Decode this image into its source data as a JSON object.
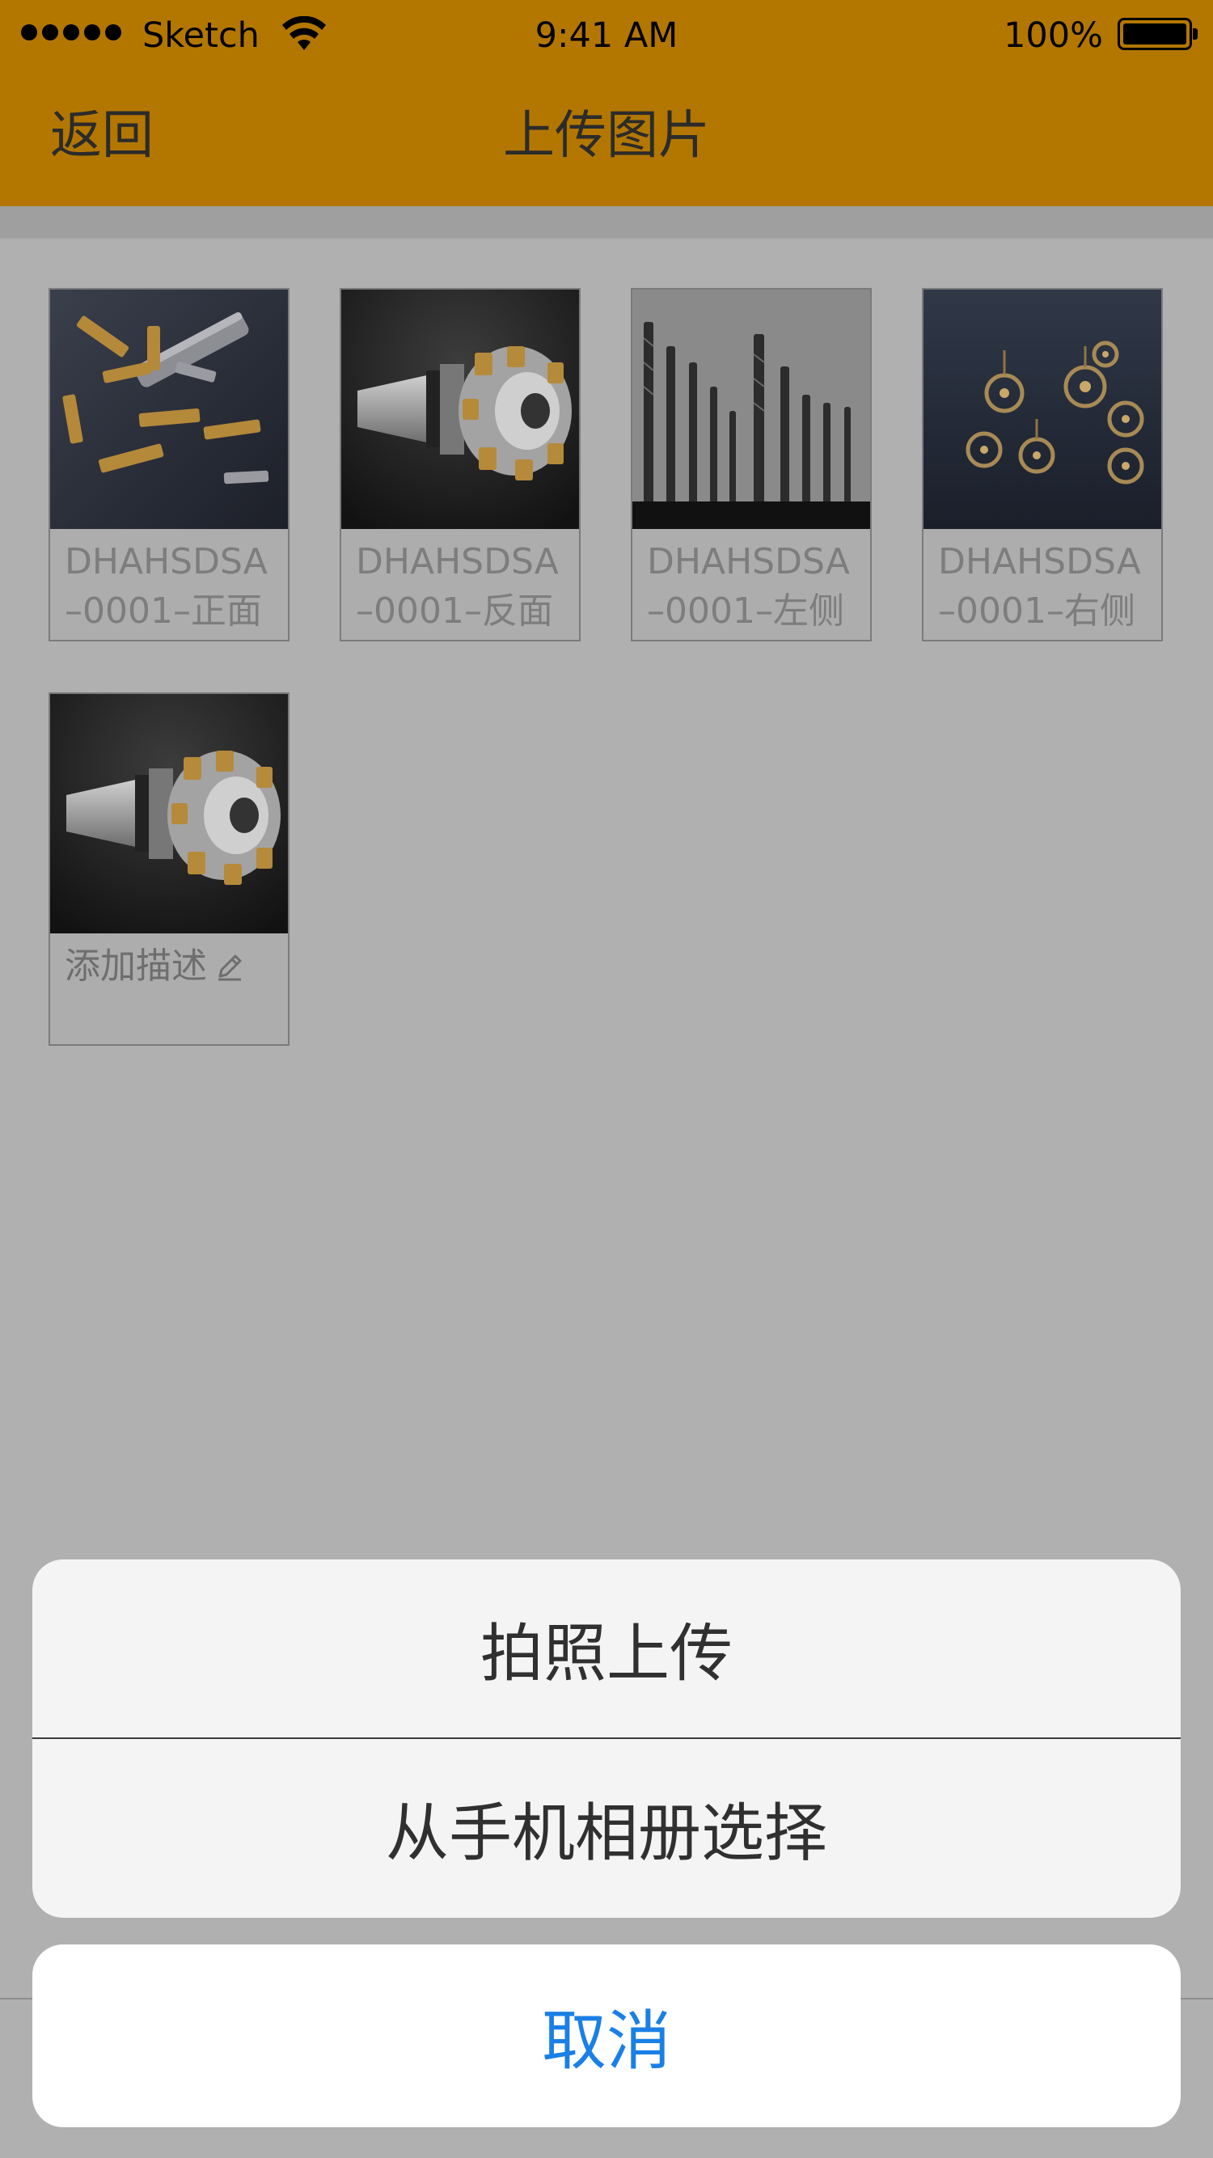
{
  "status_bar": {
    "carrier": "Sketch",
    "time": "9:41 AM",
    "battery": "100%"
  },
  "nav": {
    "back_label": "返回",
    "title": "上传图片"
  },
  "cards": [
    {
      "line1": "DHAHSDSA",
      "line2": "–0001–正面",
      "image": "torx-bits-photo"
    },
    {
      "line1": "DHAHSDSA",
      "line2": "–0001–反面",
      "image": "milling-cutter-photo"
    },
    {
      "line1": "DHAHSDSA",
      "line2": "–0001–左侧",
      "image": "drill-bits-photo"
    },
    {
      "line1": "DHAHSDSA",
      "line2": "–0001–右侧",
      "image": "watch-gears-photo"
    }
  ],
  "new_card": {
    "image": "milling-cutter-photo",
    "add_description": "添加描述",
    "icon": "pencil-icon"
  },
  "action_sheet": {
    "take_photo": "拍照上传",
    "choose_album": "从手机相册选择",
    "cancel": "取消"
  },
  "colors": {
    "nav_bg": "#b37700",
    "dim_bg": "#b0b0b0",
    "cancel_text": "#1a7fe6"
  }
}
